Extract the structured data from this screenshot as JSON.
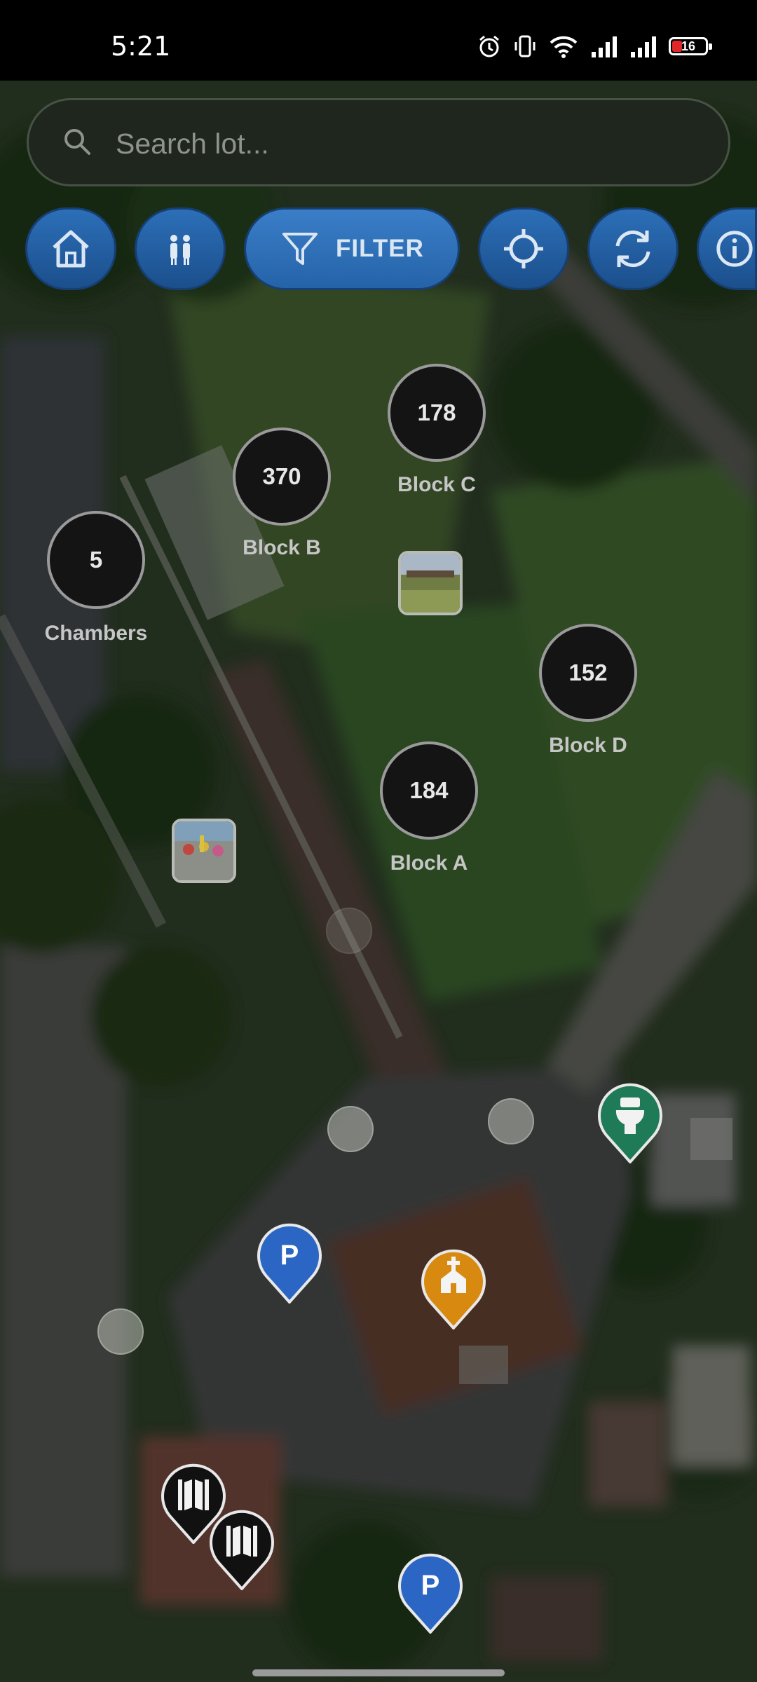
{
  "status_bar": {
    "time": "5:21",
    "battery": "16"
  },
  "search": {
    "placeholder": "Search lot..."
  },
  "toolbar": {
    "filter_label": "FILTER"
  },
  "clusters": [
    {
      "count": "178",
      "label": "Block C"
    },
    {
      "count": "370",
      "label": "Block B"
    },
    {
      "count": "5",
      "label": "Chambers"
    },
    {
      "count": "152",
      "label": "Block D"
    },
    {
      "count": "184",
      "label": "Block A"
    }
  ],
  "markers": {
    "parking_1": "P",
    "parking_2": "P"
  },
  "colors": {
    "toolbar_blue": "#2563a8",
    "toilet_pin": "#1e7a57",
    "church_pin": "#d88a10",
    "parking_pin": "#2b66c4",
    "gate_pin": "#111111"
  }
}
